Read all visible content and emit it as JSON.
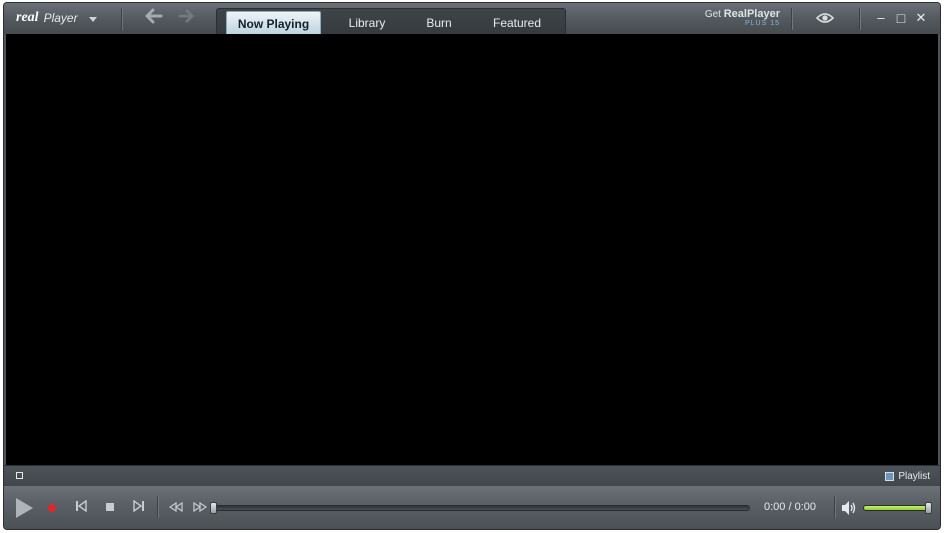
{
  "app": {
    "logo_mark": "real",
    "logo_word": "Player"
  },
  "nav": {
    "back_icon": "arrow-left-icon",
    "forward_icon": "arrow-right-icon"
  },
  "tabs": [
    {
      "label": "Now Playing",
      "active": true
    },
    {
      "label": "Library",
      "active": false
    },
    {
      "label": "Burn",
      "active": false
    },
    {
      "label": "Featured",
      "active": false
    }
  ],
  "promo": {
    "prefix": "Get ",
    "name": "RealPlayer",
    "edition": "PLUS 15"
  },
  "window_controls": {
    "minimize": "–",
    "maximize": "□",
    "close": "✕"
  },
  "status": {
    "playlist_label": "Playlist"
  },
  "playback": {
    "time_display": "0:00 / 0:00",
    "progress": 0.0,
    "volume": 1.0,
    "record_color": "#e3262d",
    "volume_color": "#8fcf2a"
  },
  "icons": {
    "play": "play-icon",
    "record": "record-icon",
    "previous": "skip-previous-icon",
    "stop": "stop-icon",
    "next": "skip-next-icon",
    "rewind": "rewind-icon",
    "fast_forward": "fast-forward-icon",
    "volume": "speaker-icon",
    "eye": "eye-icon"
  }
}
